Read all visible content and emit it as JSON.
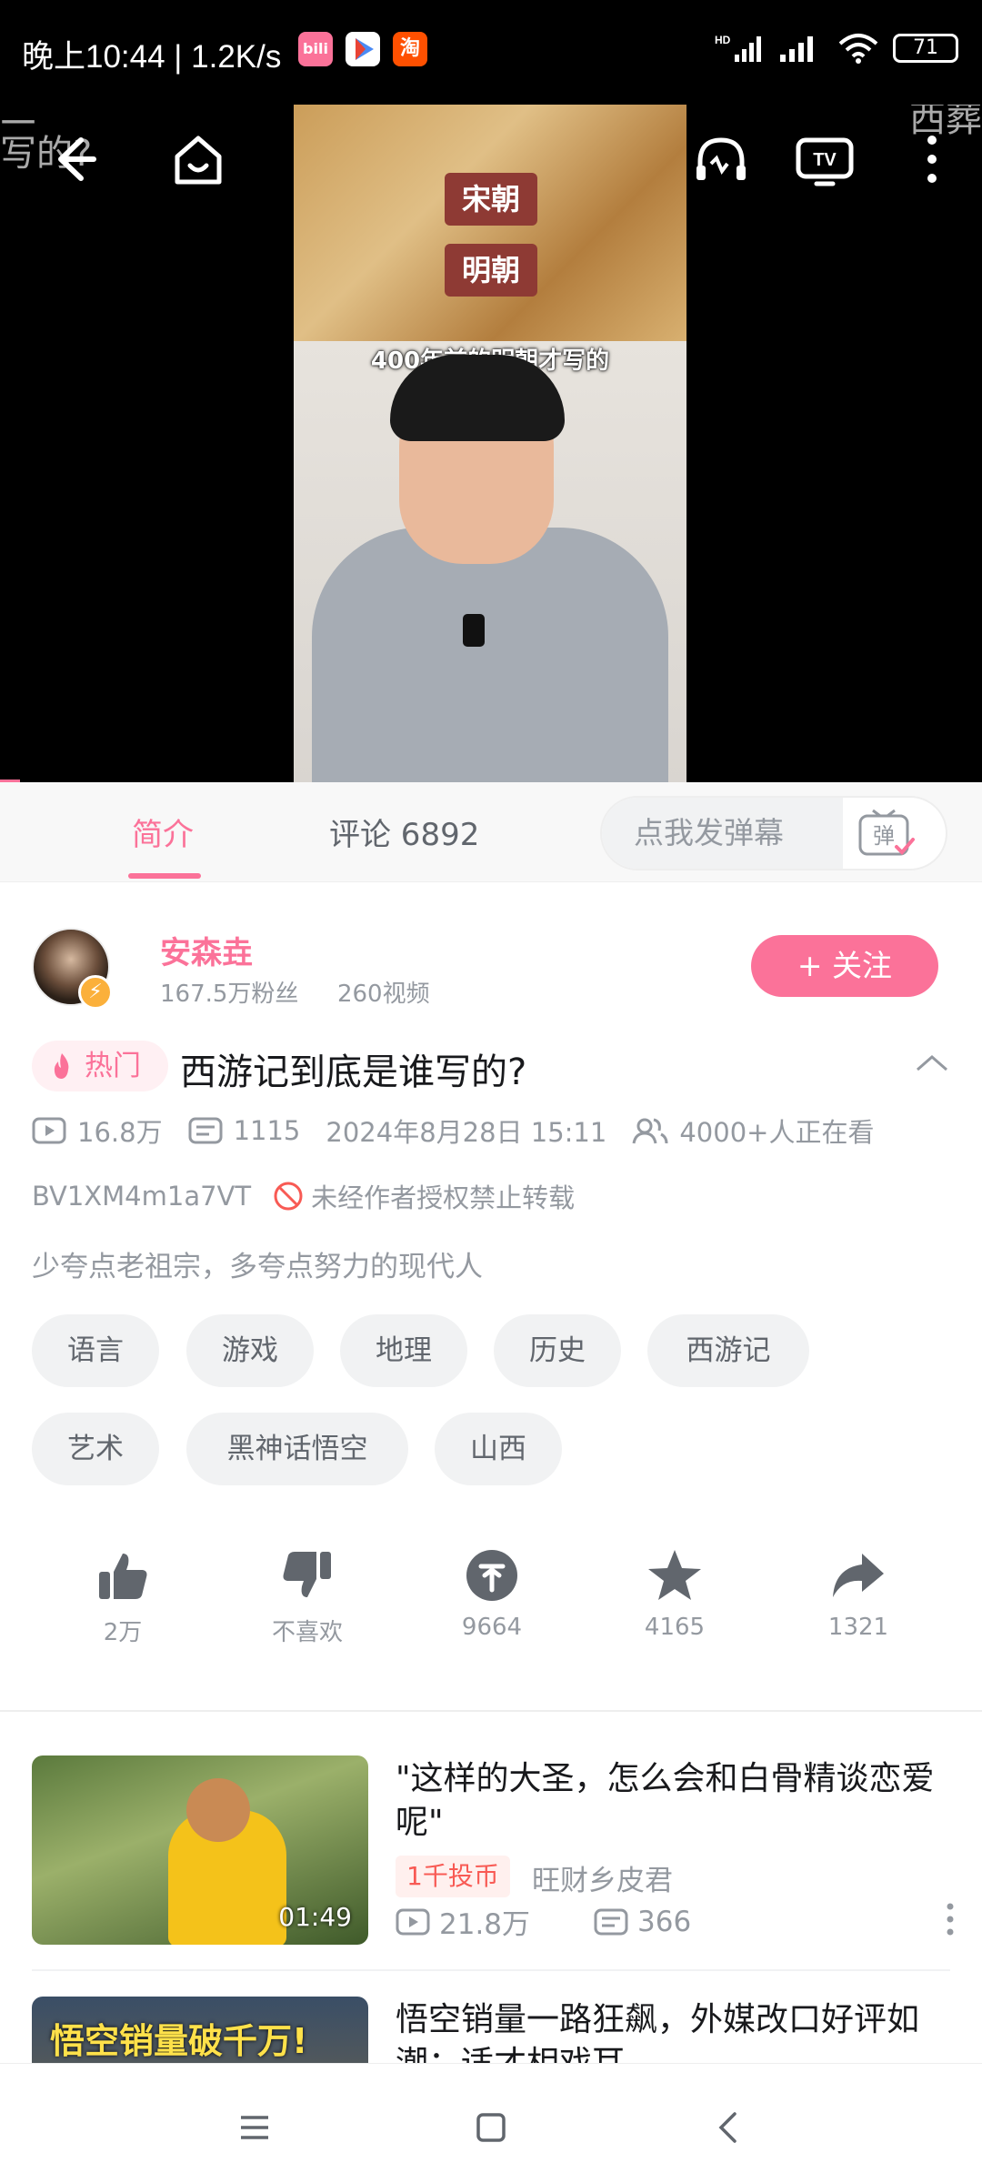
{
  "status_bar": {
    "time": "晚上10:44 | 1.2K/s",
    "battery": "71",
    "app_icon_taobao": "淘",
    "app_icon_bili": "bili"
  },
  "video": {
    "tag_top": "宋朝",
    "tag_bottom": "明朝",
    "subtitle": "400年前的明朝才写的",
    "ghost_left": "二\n写的?",
    "ghost_right": "西葬"
  },
  "tabs": {
    "intro": "简介",
    "comments": "评论 6892"
  },
  "danmu": {
    "placeholder": "点我发弹幕",
    "button_text": "弹"
  },
  "uploader": {
    "name": "安森垚",
    "fans": "167.5万粉丝",
    "videos": "260视频",
    "follow_label": "+ 关注"
  },
  "video_info": {
    "hot_label": "热门",
    "title": "西游记到底是谁写的?",
    "views": "16.8万",
    "danmaku": "1115",
    "date": "2024年8月28日 15:11",
    "watching": "4000+人正在看",
    "bvid": "BV1XM4m1a7VT",
    "copyright": "未经作者授权禁止转载",
    "description": "少夸点老祖宗，多夸点努力的现代人"
  },
  "tags": [
    "语言",
    "游戏",
    "地理",
    "历史",
    "西游记",
    "艺术",
    "黑神话悟空",
    "山西"
  ],
  "actions": {
    "like": "2万",
    "dislike": "不喜欢",
    "coin": "9664",
    "favorite": "4165",
    "share": "1321"
  },
  "recommendations": [
    {
      "title": "\"这样的大圣，怎么会和白骨精谈恋爱呢\"",
      "duration": "01:49",
      "badge": "1千投币",
      "uploader": "旺财乡皮君",
      "views": "21.8万",
      "danmaku": "366"
    },
    {
      "title": "悟空销量一路狂飙，外媒改口好评如潮：适才相戏耳",
      "thumb_text": "悟空销量破千万!"
    }
  ],
  "colors": {
    "accent": "#fb7299",
    "secondary_text": "#9499a0"
  }
}
